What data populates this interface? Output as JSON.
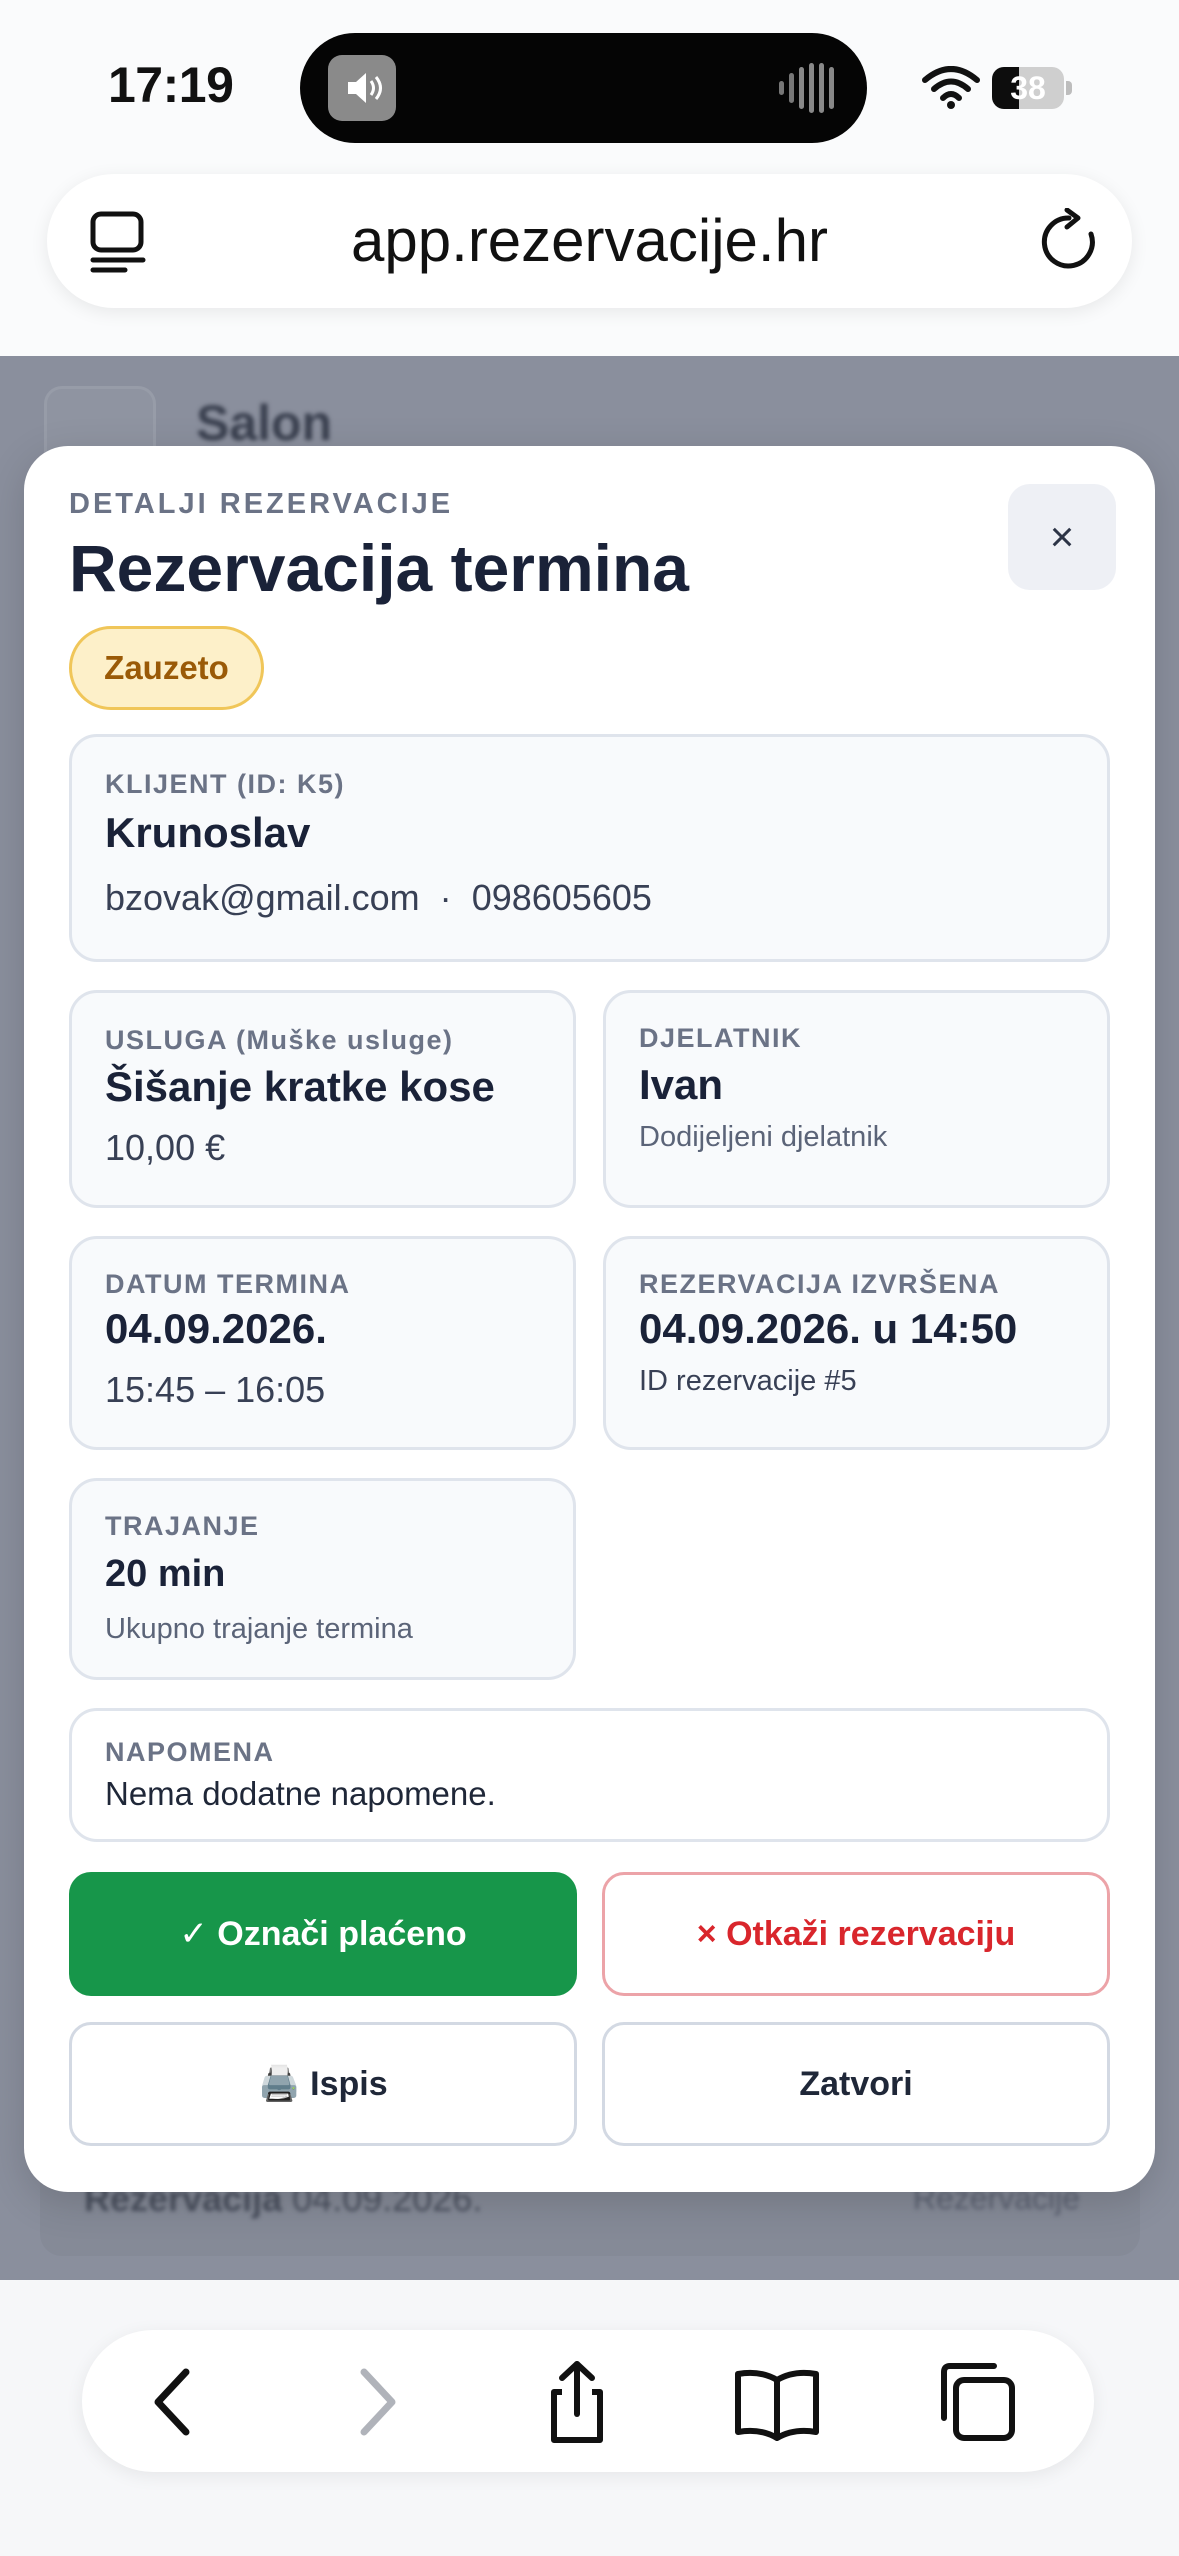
{
  "status_bar": {
    "time": "17:19",
    "battery": "38",
    "battery_level": 0.38
  },
  "browser": {
    "url": "app.rezervacije.hr"
  },
  "background_page": {
    "title": "Salon",
    "row_label": "Rezervacija",
    "row_date": "04.09.2026.",
    "row_right": "Rezervacije"
  },
  "modal": {
    "eyebrow": "DETALJI REZERVACIJE",
    "title": "Rezervacija termina",
    "close_symbol": "×",
    "status_badge": "Zauzeto",
    "client": {
      "label": "KLIJENT (ID: K5)",
      "name": "Krunoslav",
      "email": "bzovak@gmail.com",
      "separator": "·",
      "phone": "098605605"
    },
    "service": {
      "label": "USLUGA (Muške usluge)",
      "name": "Šišanje kratke kose",
      "price": "10,00 €"
    },
    "worker": {
      "label": "DJELATNIK",
      "name": "Ivan",
      "note": "Dodijeljeni djelatnik"
    },
    "date": {
      "label": "DATUM TERMINA",
      "date": "04.09.2026.",
      "time_range": "15:45 – 16:05"
    },
    "booked": {
      "label": "REZERVACIJA IZVRŠENA",
      "datetime": "04.09.2026. u 14:50",
      "id_text": "ID rezervacije #5"
    },
    "duration": {
      "label": "TRAJANJE",
      "value": "20 min",
      "note": "Ukupno trajanje termina"
    },
    "note": {
      "label": "NAPOMENA",
      "text": "Nema dodatne napomene."
    },
    "buttons": {
      "mark_paid": "✓ Označi plaćeno",
      "cancel": "× Otkaži rezervaciju",
      "print": "🖨️ Ispis",
      "close": "Zatvori"
    }
  },
  "toolbar": {
    "icons": [
      "back-icon",
      "forward-icon",
      "share-icon",
      "bookmarks-icon",
      "tabs-icon"
    ]
  },
  "colors": {
    "accent_green": "#17964a",
    "danger_red": "#d9262c",
    "badge_bg": "#fdf0c9",
    "badge_text": "#9a5a07"
  }
}
